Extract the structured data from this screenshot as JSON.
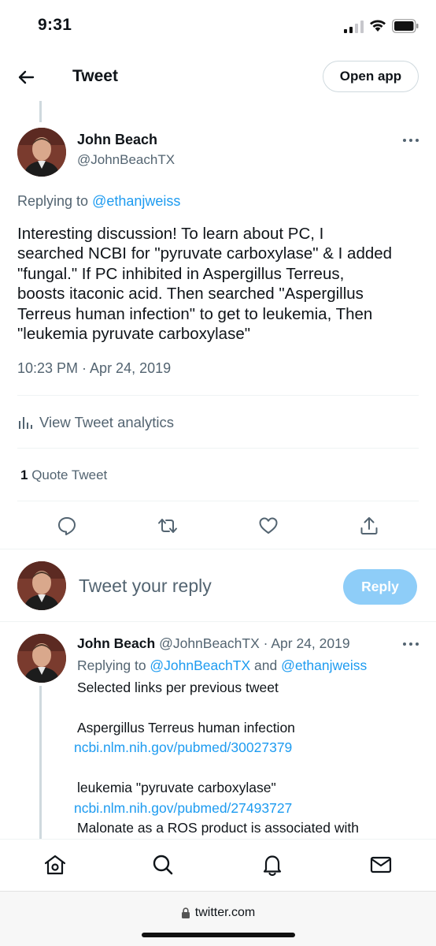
{
  "status_bar": {
    "time": "9:31"
  },
  "header": {
    "title": "Tweet",
    "open_app_label": "Open app"
  },
  "main_tweet": {
    "author_name": "John Beach",
    "author_handle": "@JohnBeachTX",
    "replying_prefix": "Replying to ",
    "replying_to": "@ethanjweiss",
    "text_lines": [
      "Interesting discussion! To learn about PC, I",
      "searched NCBI for \"pyruvate carboxylase\" & I added",
      "\"fungal.\" If PC inhibited in Aspergillus Terreus,",
      "boosts itaconic acid. Then searched \"Aspergillus",
      "Terreus human infection\" to get to leukemia, Then",
      "\"leukemia pyruvate carboxylase\""
    ],
    "timestamp": "10:23 PM · Apr 24, 2019",
    "analytics_label": "View Tweet analytics",
    "quote_count": "1",
    "quote_label": " Quote Tweet"
  },
  "reply_box": {
    "placeholder": "Tweet your reply",
    "button_label": "Reply"
  },
  "reply_tweet": {
    "author_name": "John Beach",
    "meta": " @JohnBeachTX · Apr 24, 2019",
    "replying_prefix": "Replying to ",
    "replying_to_1": "@JohnBeachTX",
    "replying_and": " and ",
    "replying_to_2": "@ethanjweiss",
    "line1": "Selected links per previous tweet",
    "line2": "Aspergillus Terreus human infection",
    "link1": "ncbi.nlm.nih.gov/pubmed/30027379",
    "line3": "leukemia \"pyruvate carboxylase\"",
    "link2": "ncbi.nlm.nih.gov/pubmed/27493727",
    "line4": "Malonate as a ROS product is associated with"
  },
  "bottom_nav": {
    "items": [
      "home-icon",
      "search-icon",
      "notifications-icon",
      "messages-icon"
    ]
  },
  "browser": {
    "url": "twitter.com"
  },
  "colors": {
    "accent": "#1d9bf0",
    "reply_button_disabled": "#8ecdf8",
    "secondary_text": "#536471"
  }
}
